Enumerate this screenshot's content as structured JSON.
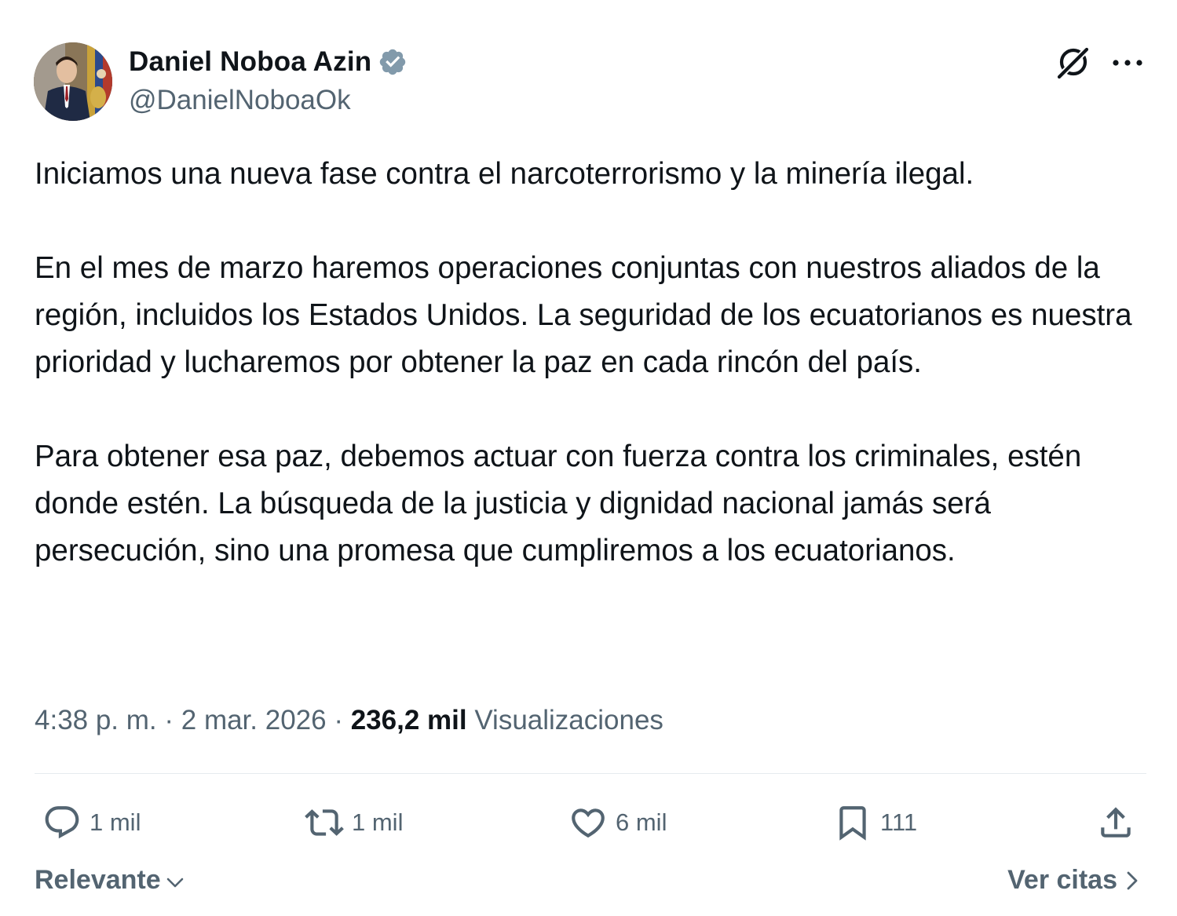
{
  "author": {
    "display_name": "Daniel Noboa Azin",
    "handle": "@DanielNoboaOk",
    "verified": true
  },
  "header_icons": [
    "grok-icon",
    "more-icon"
  ],
  "tweet": {
    "paragraphs": [
      "Iniciamos una nueva fase contra el narcoterrorismo y la minería ilegal.",
      "En el mes de marzo haremos operaciones conjuntas con nuestros aliados de la región, incluidos los Estados Unidos. La seguridad de los ecuatorianos es nuestra prioridad y lucharemos por obtener la paz en cada rincón del país.",
      "Para obtener esa paz, debemos actuar con fuerza contra los criminales, estén donde estén. La búsqueda de la justicia y dignidad nacional jamás será persecución, sino una promesa que cumpliremos a los ecuatorianos."
    ]
  },
  "meta": {
    "time": "4:38 p. m.",
    "separator": " · ",
    "date": "2 mar. 2026",
    "views_count": "236,2 mil",
    "views_label": "Visualizaciones"
  },
  "actions": {
    "reply": {
      "icon": "reply-icon",
      "count": "1 mil"
    },
    "retweet": {
      "icon": "retweet-icon",
      "count": "1 mil"
    },
    "like": {
      "icon": "heart-icon",
      "count": "6 mil"
    },
    "bookmark": {
      "icon": "bookmark-icon",
      "count": "111"
    },
    "share": {
      "icon": "share-icon"
    }
  },
  "footer": {
    "sort_label": "Relevante",
    "quotes_label": "Ver citas"
  },
  "colors": {
    "text_primary": "#0f1419",
    "text_secondary": "#536471",
    "verified_badge": "#829aab",
    "divider": "#e6ebee"
  }
}
